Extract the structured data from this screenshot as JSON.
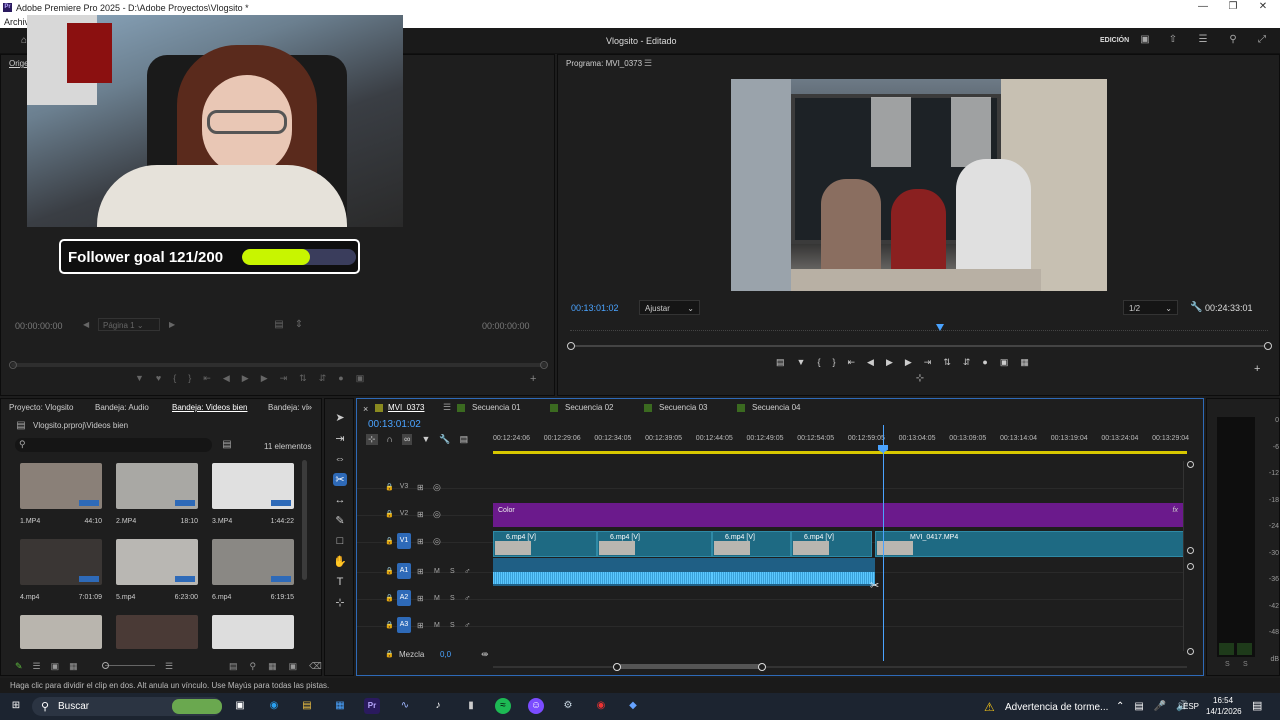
{
  "app": {
    "title": "Adobe Premiere Pro 2025 - D:\\Adobe Proyectos\\Vlogsito *",
    "menu_first": "Archivo",
    "project_title": "Vlogsito - Editado",
    "workspace": "EDICIÓN"
  },
  "overlay": {
    "follower_goal": "Follower goal 121/200",
    "follower_progress": 0.6
  },
  "source_monitor": {
    "tab": "Orige",
    "timecode_left": "00:00:00:00",
    "page": "Página 1",
    "timecode_right": "00:00:00:00"
  },
  "program_monitor": {
    "tab": "Programa: MVI_0373",
    "timecode": "00:13:01:02",
    "fit": "Ajustar",
    "resolution": "1/2",
    "duration": "00:24:33:01"
  },
  "project_panel": {
    "tabs": [
      "Proyecto: Vlogsito",
      "Bandeja: Audio",
      "Bandeja: Videos bien",
      "Bandeja: ví"
    ],
    "path": "Vlogsito.prproj\\Videos bien",
    "count": "11 elementos",
    "items": [
      {
        "name": "1.MP4",
        "dur": "44:10"
      },
      {
        "name": "2.MP4",
        "dur": "18:10"
      },
      {
        "name": "3.MP4",
        "dur": "1:44:22"
      },
      {
        "name": "4.mp4",
        "dur": "7:01:09"
      },
      {
        "name": "5.mp4",
        "dur": "6:23:00"
      },
      {
        "name": "6.mp4",
        "dur": "6:19:15"
      }
    ]
  },
  "timeline": {
    "tabs": [
      "MVI_0373",
      "Secuencia 01",
      "Secuencia 02",
      "Secuencia 03",
      "Secuencia 04"
    ],
    "timecode": "00:13:01:02",
    "ruler": [
      "00:12:24:06",
      "00:12:29:06",
      "00:12:34:05",
      "00:12:39:05",
      "00:12:44:05",
      "00:12:49:05",
      "00:12:54:05",
      "00:12:59:05",
      "00:13:04:05",
      "00:13:09:05",
      "00:13:14:04",
      "00:13:19:04",
      "00:13:24:04",
      "00:13:29:04"
    ],
    "tracks": {
      "v3": "V3",
      "v2": "V2",
      "v1": "V1",
      "a1": "A1",
      "a2": "A2",
      "a3": "A3",
      "m": "M",
      "s": "S"
    },
    "v2_clip": "Color",
    "v1_clips": [
      "6.mp4 [V]",
      "6.mp4 [V]",
      "6.mp4 [V]",
      "6.mp4 [V]",
      "MVI_0417.MP4"
    ],
    "fx": "fx",
    "mix_label": "Mezcla",
    "mix_value": "0,0"
  },
  "meter": {
    "labels": [
      "0",
      "-6",
      "-12",
      "-18",
      "-24",
      "-30",
      "-36",
      "-42",
      "-48",
      "dB"
    ],
    "s_left": "S",
    "s_right": "S"
  },
  "status_bar": "Haga clic para dividir el clip en dos. Alt anula un vínculo. Use Mayús para todas las pistas.",
  "taskbar": {
    "search": "Buscar",
    "weather": "Advertencia de torme...",
    "lang": "ESP",
    "time": "16:54",
    "date": "14/1/2026"
  },
  "colors": {
    "accent": "#4aa3ff",
    "color_matte": "#6b1a8c",
    "video_clip": "#1e6a83",
    "audio_clip": "#1f5f85",
    "progress": "#c8f500"
  }
}
